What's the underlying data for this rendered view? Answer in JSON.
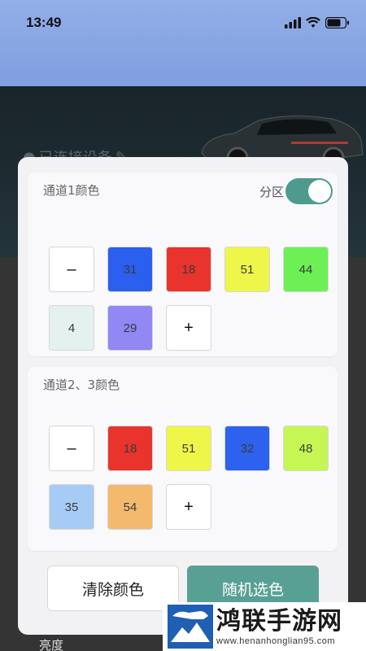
{
  "status_bar": {
    "time": "13:49"
  },
  "background": {
    "page_title": "已连接设备",
    "bottom_label": "亮度"
  },
  "channel1": {
    "title": "通道1颜色",
    "partition_label": "分区",
    "partition_on": true,
    "minus_label": "–",
    "plus_label": "+",
    "swatches": [
      {
        "value": "31",
        "color": "#2a5ff0"
      },
      {
        "value": "18",
        "color": "#e8342c"
      },
      {
        "value": "51",
        "color": "#eef64a"
      },
      {
        "value": "44",
        "color": "#6cf055"
      },
      {
        "value": "4",
        "color": "#e4f1ee"
      },
      {
        "value": "29",
        "color": "#9188f4"
      }
    ]
  },
  "channel23": {
    "title": "通道2、3颜色",
    "minus_label": "–",
    "plus_label": "+",
    "swatches": [
      {
        "value": "18",
        "color": "#e8342c"
      },
      {
        "value": "51",
        "color": "#eef64a"
      },
      {
        "value": "32",
        "color": "#2d62ee"
      },
      {
        "value": "48",
        "color": "#c6f653"
      },
      {
        "value": "35",
        "color": "#a6ccf6"
      },
      {
        "value": "54",
        "color": "#f3ba6e"
      }
    ]
  },
  "actions": {
    "clear_label": "清除颜色",
    "random_label": "随机选色"
  },
  "watermark": {
    "title": "鸿联手游网",
    "url": "www.henanhonglian95.com"
  }
}
